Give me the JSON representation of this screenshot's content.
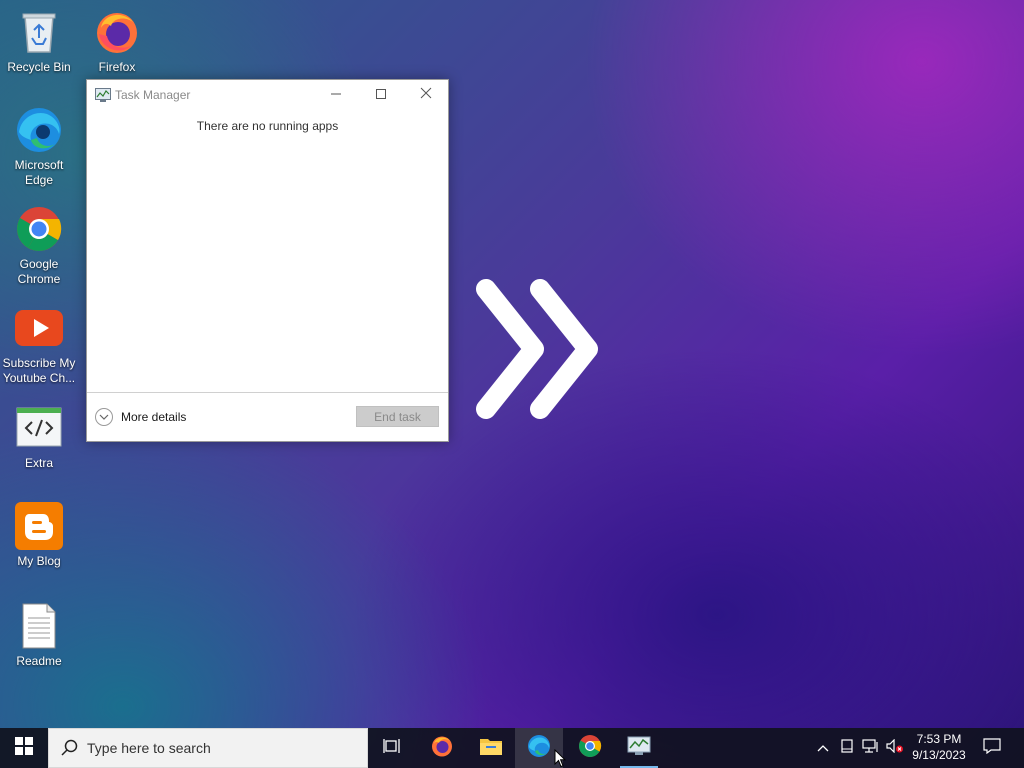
{
  "desktop": {
    "icons": [
      {
        "label": "Recycle Bin"
      },
      {
        "label": "Firefox"
      },
      {
        "label": "Microsoft Edge"
      },
      {
        "label": "Google Chrome"
      },
      {
        "label": "Subscribe My Youtube Ch..."
      },
      {
        "label": "Extra"
      },
      {
        "label": "My Blog"
      },
      {
        "label": "Readme"
      }
    ]
  },
  "task_manager": {
    "title": "Task Manager",
    "message": "There are no running apps",
    "more_details_label": "More details",
    "end_task_label": "End task"
  },
  "taskbar": {
    "search_placeholder": "Type here to search",
    "apps": [
      {
        "name": "Task View"
      },
      {
        "name": "Firefox"
      },
      {
        "name": "File Explorer"
      },
      {
        "name": "Microsoft Edge"
      },
      {
        "name": "Google Chrome"
      },
      {
        "name": "Task Manager"
      }
    ],
    "clock": {
      "time": "7:53 PM",
      "date": "9/13/2023"
    }
  },
  "colors": {
    "taskbar_bg": "#10121e",
    "accent_underline": "#76b9ed",
    "window_bg": "#ffffff"
  }
}
